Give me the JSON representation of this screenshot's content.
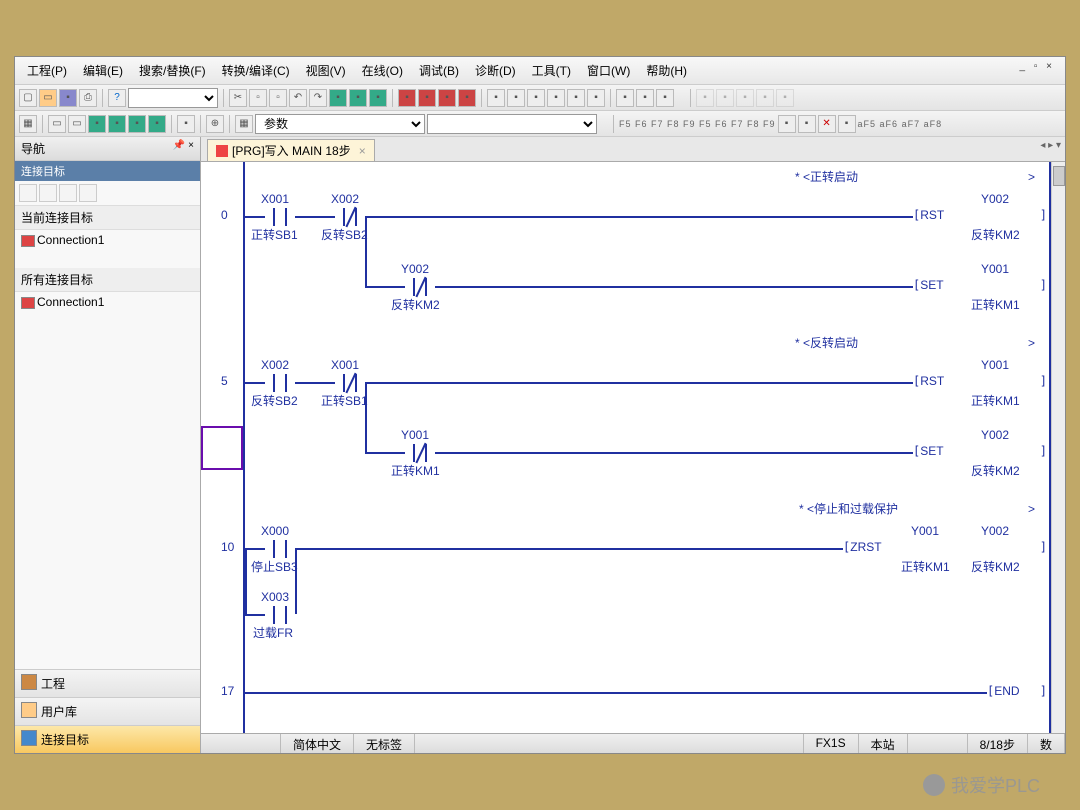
{
  "menu": [
    "工程(P)",
    "编辑(E)",
    "搜索/替换(F)",
    "转换/编译(C)",
    "视图(V)",
    "在线(O)",
    "调试(B)",
    "诊断(D)",
    "工具(T)",
    "窗口(W)",
    "帮助(H)"
  ],
  "combo_param": "参数",
  "sidebar": {
    "title": "导航",
    "header": "连接目标",
    "sect1": "当前连接目标",
    "conn": "Connection1",
    "sect2": "所有连接目标",
    "nav": [
      "工程",
      "用户库",
      "连接目标"
    ]
  },
  "tab": "[PRG]写入 MAIN 18步",
  "rungs": {
    "c0": "* <正转启动",
    "s0": "0",
    "x001": "X001",
    "x001d": "正转SB1",
    "x002": "X002",
    "x002d": "反转SB2",
    "rst": "RST",
    "y002": "Y002",
    "y002d": "反转KM2",
    "y002b": "Y002",
    "y002bd": "反转KM2",
    "set": "SET",
    "y001": "Y001",
    "y001d": "正转KM1",
    "c1": "* <反转启动",
    "s5": "5",
    "y001b": "Y001",
    "y001bd": "正转KM1",
    "c2": "* <停止和过载保护",
    "s10": "10",
    "x000": "X000",
    "x000d": "停止SB3",
    "x003": "X003",
    "x003d": "过载FR",
    "zrst": "ZRST",
    "s17": "17",
    "end": "END"
  },
  "status": {
    "lang": "简体中文",
    "tag": "无标签",
    "plc": "FX1S",
    "station": "本站",
    "step": "8/18步",
    "num": "数"
  },
  "watermark": "我爱学PLC"
}
